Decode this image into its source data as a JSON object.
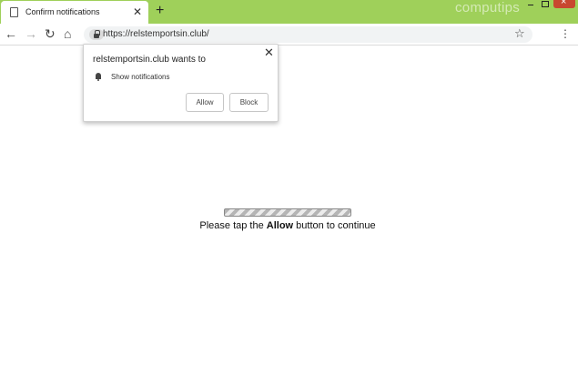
{
  "browser": {
    "tab": {
      "title": "Confirm notifications",
      "icon": "page-icon"
    },
    "watermark": "computips",
    "address_bar": {
      "url": "https://relstemportsin.club/"
    }
  },
  "permission_popup": {
    "title": "relstemportsin.club wants to",
    "permission": "Show notifications",
    "allow_label": "Allow",
    "block_label": "Block"
  },
  "page": {
    "message_before": "Please tap the ",
    "message_bold": "Allow",
    "message_after": " button to continue"
  }
}
